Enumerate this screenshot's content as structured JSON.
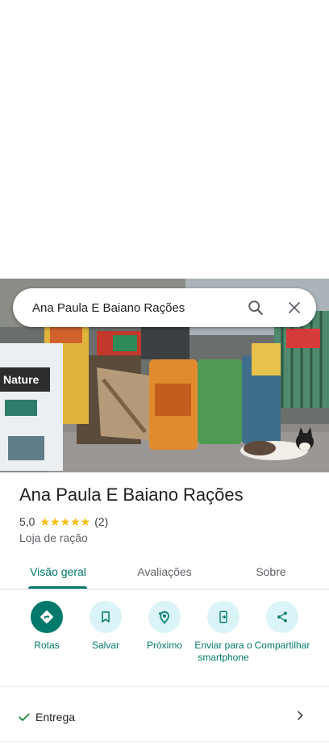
{
  "search": {
    "query": "Ana Paula E Baiano Rações"
  },
  "place": {
    "name": "Ana Paula E Baiano Rações",
    "rating_value": "5,0",
    "stars": "★★★★★",
    "rating_count": "(2)",
    "category": "Loja de ração"
  },
  "tabs": [
    {
      "label": "Visão geral",
      "active": true
    },
    {
      "label": "Avaliações",
      "active": false
    },
    {
      "label": "Sobre",
      "active": false
    }
  ],
  "actions": [
    {
      "label": "Rotas",
      "icon": "directions-icon"
    },
    {
      "label": "Salvar",
      "icon": "bookmark-icon"
    },
    {
      "label": "Próximo",
      "icon": "nearby-icon"
    },
    {
      "label": "Enviar para o smartphone",
      "icon": "send-to-phone-icon"
    },
    {
      "label": "Compartilhar",
      "icon": "share-icon"
    }
  ],
  "attributes": [
    {
      "label": "Entrega",
      "icon": "check-icon"
    }
  ],
  "colors": {
    "accent": "#00796b",
    "accent_light": "#dbf4f7",
    "star": "#fbbc04"
  }
}
